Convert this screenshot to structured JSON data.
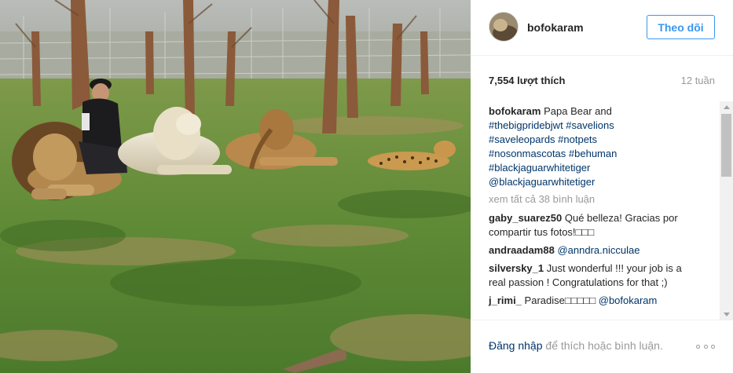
{
  "post": {
    "username": "bofokaram",
    "follow_label": "Theo dõi",
    "likes": "7,554 lượt thích",
    "time_ago": "12 tuần",
    "caption": {
      "username": "bofokaram",
      "text": "Papa Bear and",
      "hashtags": [
        "#thebigpridebjwt #savelions",
        "#saveleopards #notpets",
        "#nosonmascotas #behuman",
        "#blackjaguarwhitetiger",
        "@blackjaguarwhitetiger"
      ]
    },
    "view_all_comments": "xem tất cả 38 bình luận",
    "comments": [
      {
        "user": "gaby_suarez50",
        "text": "Qué belleza! Gracias por compartir tus fotos!",
        "emoji": "□□□"
      },
      {
        "user": "andraadam88",
        "mention": "@anndra.nicculae"
      },
      {
        "user": "silversky_1",
        "text": "Just wonderful !!! your job is a real passion ! Congratulations for that ;)"
      },
      {
        "user": "j_rimi_",
        "text": "Paradise",
        "emoji": "□□□□□",
        "mention": "@bofokaram"
      }
    ],
    "footer": {
      "login_link": "Đăng nhập",
      "login_rest": " để thích hoặc bình luận."
    }
  },
  "icons": {
    "more": "more-options-icon",
    "scroll_up": "scroll-up-arrow-icon",
    "scroll_down": "scroll-down-arrow-icon"
  },
  "colors": {
    "link": "#003569",
    "follow_accent": "#3897f0",
    "muted": "#999999",
    "text": "#262626"
  }
}
